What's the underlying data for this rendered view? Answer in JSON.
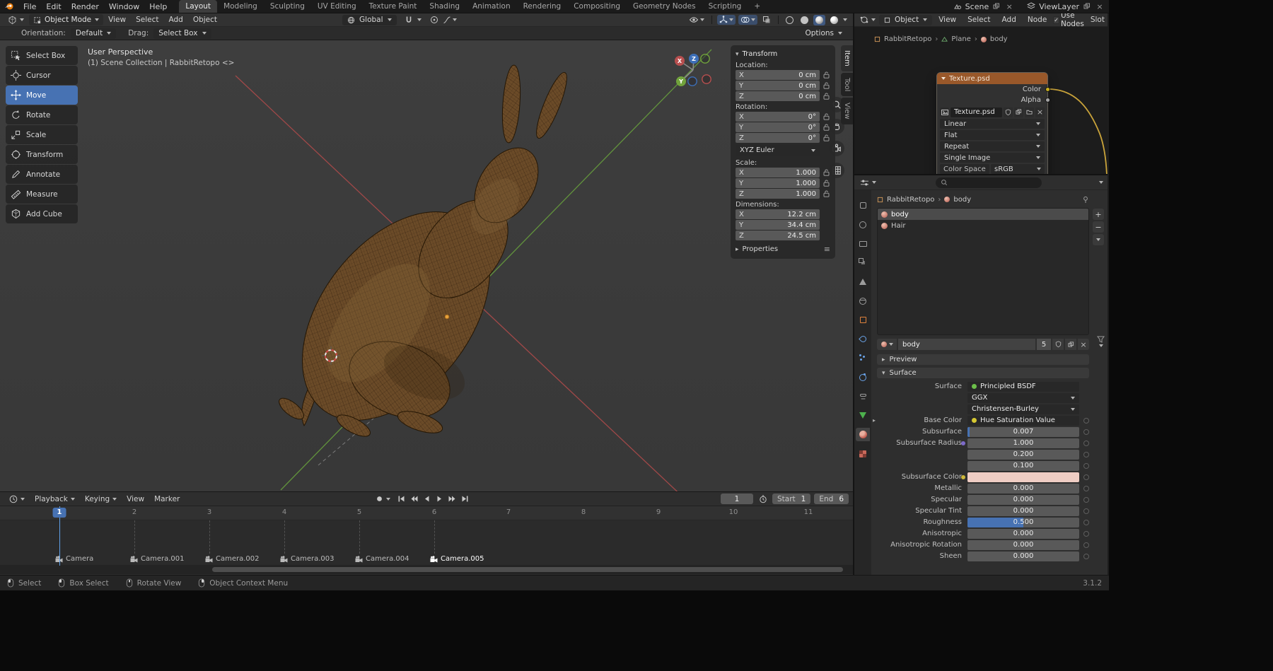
{
  "colors": {
    "accent_blue": "#4772b3",
    "node_header_orange": "#99582a",
    "subsurface_color_swatch": "#efcdc4",
    "axis_x_red": "#b34b4b",
    "axis_y_green": "#69a33d",
    "axis_z_blue": "#3a75c4"
  },
  "topbar": {
    "menus": [
      "File",
      "Edit",
      "Render",
      "Window",
      "Help"
    ],
    "workspaces": [
      "Layout",
      "Modeling",
      "Sculpting",
      "UV Editing",
      "Texture Paint",
      "Shading",
      "Animation",
      "Rendering",
      "Compositing",
      "Geometry Nodes",
      "Scripting"
    ],
    "active_workspace": "Layout",
    "add_workspace": "+",
    "scene_label": "Scene",
    "viewlayer_label": "ViewLayer"
  },
  "viewport_header": {
    "mode": "Object Mode",
    "menus": [
      "View",
      "Select",
      "Add",
      "Object"
    ],
    "orientation": "Global"
  },
  "tool_settings": {
    "orientation_label": "Orientation:",
    "orientation_value": "Default",
    "drag_label": "Drag:",
    "drag_value": "Select Box",
    "options_label": "Options"
  },
  "toolbar": {
    "items": [
      "Select Box",
      "Cursor",
      "Move",
      "Rotate",
      "Scale",
      "Transform",
      "Annotate",
      "Measure",
      "Add Cube"
    ],
    "active": "Move"
  },
  "viewport": {
    "perspective_label": "User Perspective",
    "collection_label": "(1) Scene Collection | RabbitRetopo <>",
    "axis_x": "X",
    "axis_y": "Y",
    "axis_z": "Z"
  },
  "npanel": {
    "transform_title": "Transform",
    "location_label": "Location:",
    "loc": [
      {
        "axis": "X",
        "value": "0 cm"
      },
      {
        "axis": "Y",
        "value": "0 cm"
      },
      {
        "axis": "Z",
        "value": "0 cm"
      }
    ],
    "rotation_label": "Rotation:",
    "rot": [
      {
        "axis": "X",
        "value": "0°"
      },
      {
        "axis": "Y",
        "value": "0°"
      },
      {
        "axis": "Z",
        "value": "0°"
      }
    ],
    "rotation_mode": "XYZ Euler",
    "scale_label": "Scale:",
    "scl": [
      {
        "axis": "X",
        "value": "1.000"
      },
      {
        "axis": "Y",
        "value": "1.000"
      },
      {
        "axis": "Z",
        "value": "1.000"
      }
    ],
    "dimensions_label": "Dimensions:",
    "dim": [
      {
        "axis": "X",
        "value": "12.2 cm"
      },
      {
        "axis": "Y",
        "value": "34.4 cm"
      },
      {
        "axis": "Z",
        "value": "24.5 cm"
      }
    ],
    "properties_title": "Properties",
    "tabs": [
      "Item",
      "Tool",
      "View"
    ],
    "active_tab": "Item"
  },
  "node_editor": {
    "shader_type": "Object",
    "menus": [
      "View",
      "Select",
      "Add",
      "Node"
    ],
    "use_nodes_label": "Use Nodes",
    "slot_label": "Slot",
    "breadcrumb": [
      "RabbitRetopo",
      "Plane",
      "body"
    ],
    "node": {
      "title": "Texture.psd",
      "outputs": [
        "Color",
        "Alpha"
      ],
      "image_name": "Texture.psd",
      "interpolation": "Linear",
      "projection": "Flat",
      "extension": "Repeat",
      "source": "Single Image",
      "color_space_label": "Color Space",
      "color_space_value": "sRGB"
    }
  },
  "properties": {
    "breadcrumb": [
      "RabbitRetopo",
      "body"
    ],
    "slots": [
      "body",
      "Hair"
    ],
    "active_slot": "body",
    "material_name": "body",
    "users_count": "5",
    "preview_title": "Preview",
    "surface_title": "Surface",
    "surface": {
      "surface_label": "Surface",
      "surface_value": "Principled BSDF",
      "distribution_value": "GGX",
      "subsurface_method_value": "Christensen-Burley",
      "base_color_label": "Base Color",
      "base_color_value": "Hue Saturation Value",
      "subsurface_label": "Subsurface",
      "subsurface_value": "0.007",
      "radius_label": "Subsurface Radius",
      "radius_1": "1.000",
      "radius_2": "0.200",
      "radius_3": "0.100",
      "sss_color_label": "Subsurface Color",
      "metallic_label": "Metallic",
      "metallic_value": "0.000",
      "specular_label": "Specular",
      "specular_value": "0.000",
      "specular_tint_label": "Specular Tint",
      "specular_tint_value": "0.000",
      "roughness_label": "Roughness",
      "roughness_value": "0.500",
      "anisotropic_label": "Anisotropic",
      "anisotropic_value": "0.000",
      "anisotropic_rotation_label": "Anisotropic Rotation",
      "anisotropic_rotation_value": "0.000",
      "sheen_label": "Sheen",
      "sheen_value": "0.000"
    }
  },
  "timeline": {
    "menus": [
      "Playback",
      "Keying",
      "View",
      "Marker"
    ],
    "current_frame": "1",
    "frames": [
      "1",
      "2",
      "3",
      "4",
      "5",
      "6",
      "7",
      "8",
      "9",
      "10",
      "11"
    ],
    "start_label": "Start",
    "start_value": "1",
    "end_label": "End",
    "end_value": "6",
    "markers": [
      "Camera",
      "Camera.001",
      "Camera.002",
      "Camera.003",
      "Camera.004",
      "Camera.005"
    ],
    "active_marker": "Camera.005"
  },
  "statusbar": {
    "items": [
      "Select",
      "Box Select",
      "Rotate View",
      "Object Context Menu"
    ],
    "version": "3.1.2"
  }
}
